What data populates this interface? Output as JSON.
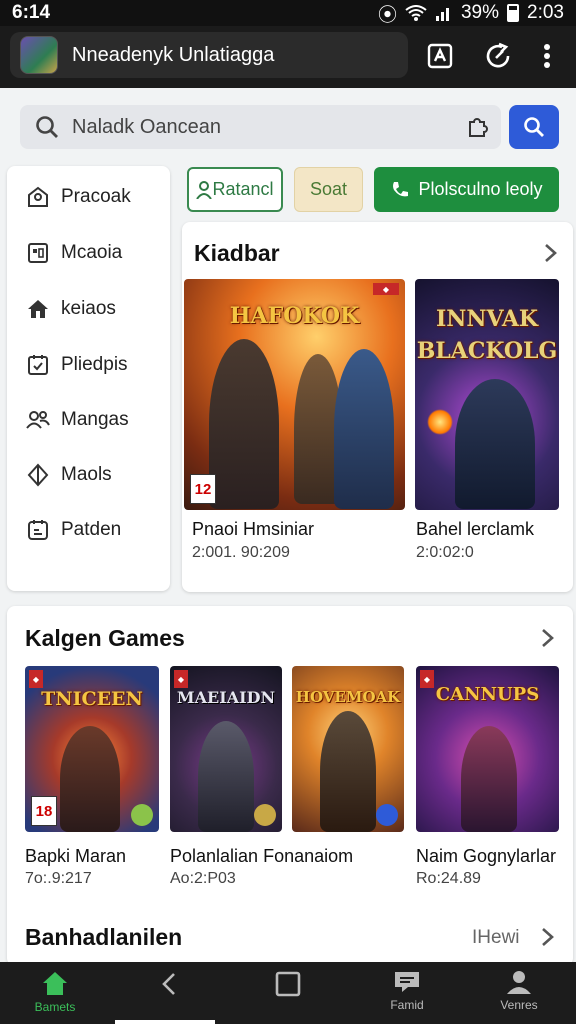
{
  "status_bar": {
    "time_left": "6:14",
    "battery": "39%",
    "time_right": "2:03"
  },
  "browser": {
    "url_title": "Nneadenyk Unlatiagga"
  },
  "search": {
    "placeholder": "Naladk Oancean"
  },
  "sidebar": {
    "items": [
      {
        "label": "Pracoak",
        "icon": "person-outline-icon"
      },
      {
        "label": "Mcaoia",
        "icon": "grid-box-icon"
      },
      {
        "label": "keiaos",
        "icon": "home-icon"
      },
      {
        "label": "Pliedpis",
        "icon": "calendar-check-icon"
      },
      {
        "label": "Mangas",
        "icon": "people-icon"
      },
      {
        "label": "Maols",
        "icon": "shield-icon"
      },
      {
        "label": "Patden",
        "icon": "document-icon"
      }
    ]
  },
  "buttons": {
    "outline": "Ratancl",
    "tan": "Soat",
    "green": "Plolsculno leoly"
  },
  "featured": {
    "title": "Kiadbar",
    "games": [
      {
        "cover_title": "HAFOKOK",
        "name": "Pnaoi Hmsiniar",
        "sub": "2:001. 90:209",
        "rating": "12"
      },
      {
        "cover_title": "INNVAK BLACKOLG",
        "name": "Bahel lerclamk",
        "sub": "2:0:02:0"
      }
    ]
  },
  "kalgen": {
    "title": "Kalgen Games",
    "games": [
      {
        "cover_title": "TNICEEN",
        "name": "Bapki Maran",
        "sub": "7o:.9:217",
        "rating": "18"
      },
      {
        "cover_title": "MAEIAIDN",
        "name": "Polanlalian Fonanaiom",
        "sub": "Ao:2:P03"
      },
      {
        "cover_title": "HOVEMOAK",
        "name": "",
        "sub": ""
      },
      {
        "cover_title": "CANNUPS",
        "name": "Naim Gognylarlar",
        "sub": "Ro:24.89"
      }
    ]
  },
  "bottom_section": {
    "title": "Banhadlanilen",
    "link": "IHewi"
  },
  "nav": {
    "home": "Bamets",
    "second": "Famid",
    "third": "Venres"
  },
  "colors": {
    "accent_blue": "#2e5bd8",
    "accent_green": "#1e8e3e"
  }
}
